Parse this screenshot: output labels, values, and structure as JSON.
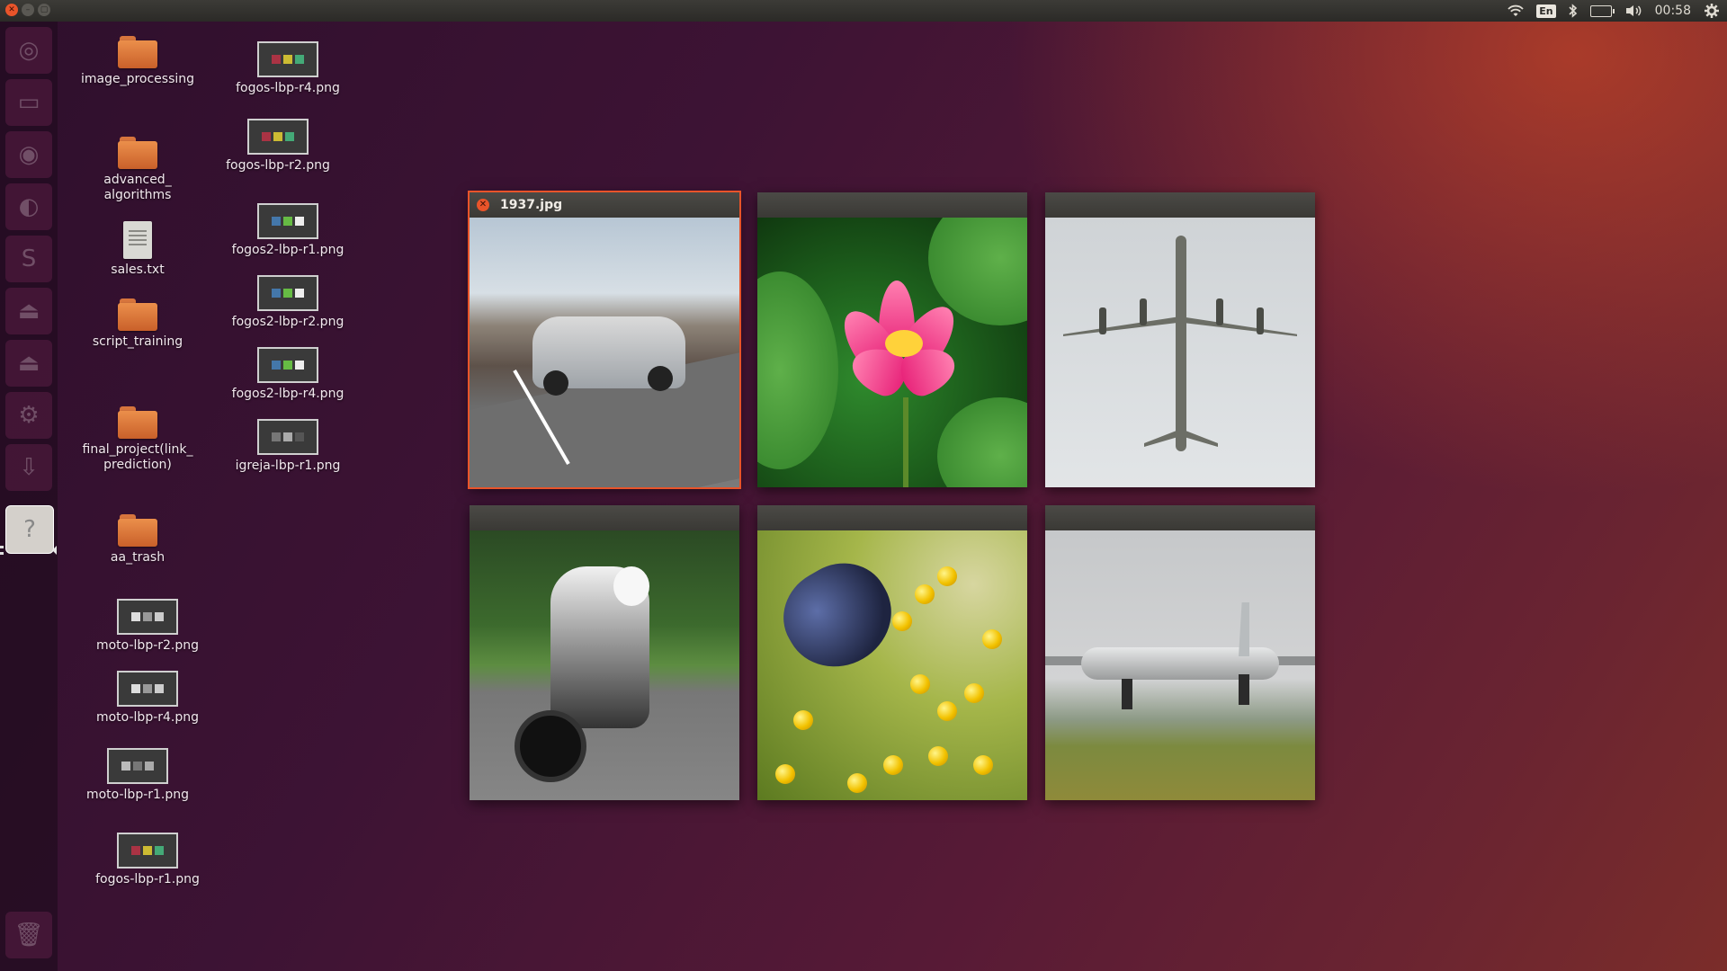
{
  "top_panel": {
    "language": "En",
    "clock": "00:58"
  },
  "launcher": {
    "items": [
      "ubuntu-dash",
      "files",
      "browser",
      "firefox",
      "software-center",
      "drive-1",
      "drive-2",
      "system-settings",
      "downloads",
      "help"
    ],
    "active_item": "help"
  },
  "desktop": {
    "icons": [
      {
        "label": "image_processing",
        "kind": "folder"
      },
      {
        "label": "advanced_ algorithms",
        "kind": "folder"
      },
      {
        "label": "sales.txt",
        "kind": "text"
      },
      {
        "label": "script_training",
        "kind": "folder"
      },
      {
        "label": "final_project(link_ prediction)",
        "kind": "folder"
      },
      {
        "label": "aa_trash",
        "kind": "folder"
      },
      {
        "label": "moto-lbp-r2.png",
        "kind": "image"
      },
      {
        "label": "moto-lbp-r4.png",
        "kind": "image"
      },
      {
        "label": "moto-lbp-r1.png",
        "kind": "image"
      },
      {
        "label": "fogos-lbp-r1.png",
        "kind": "image"
      },
      {
        "label": "fogos-lbp-r4.png",
        "kind": "image"
      },
      {
        "label": "fogos-lbp-r2.png",
        "kind": "image"
      },
      {
        "label": "fogos2-lbp-r1.png",
        "kind": "image"
      },
      {
        "label": "fogos2-lbp-r2.png",
        "kind": "image"
      },
      {
        "label": "fogos2-lbp-r4.png",
        "kind": "image"
      },
      {
        "label": "igreja-lbp-r1.png",
        "kind": "image"
      }
    ]
  },
  "spread": {
    "windows": [
      {
        "title": "1937.jpg",
        "focused": true,
        "subject": "car"
      },
      {
        "title": "",
        "focused": false,
        "subject": "lotus"
      },
      {
        "title": "",
        "focused": false,
        "subject": "airplane"
      },
      {
        "title": "",
        "focused": false,
        "subject": "motorcycle"
      },
      {
        "title": "",
        "focused": false,
        "subject": "beetle"
      },
      {
        "title": "",
        "focused": false,
        "subject": "airplane"
      }
    ]
  },
  "colors": {
    "accent": "#e9542a",
    "panel": "#3c3b37",
    "folder": "#e07a3a"
  }
}
